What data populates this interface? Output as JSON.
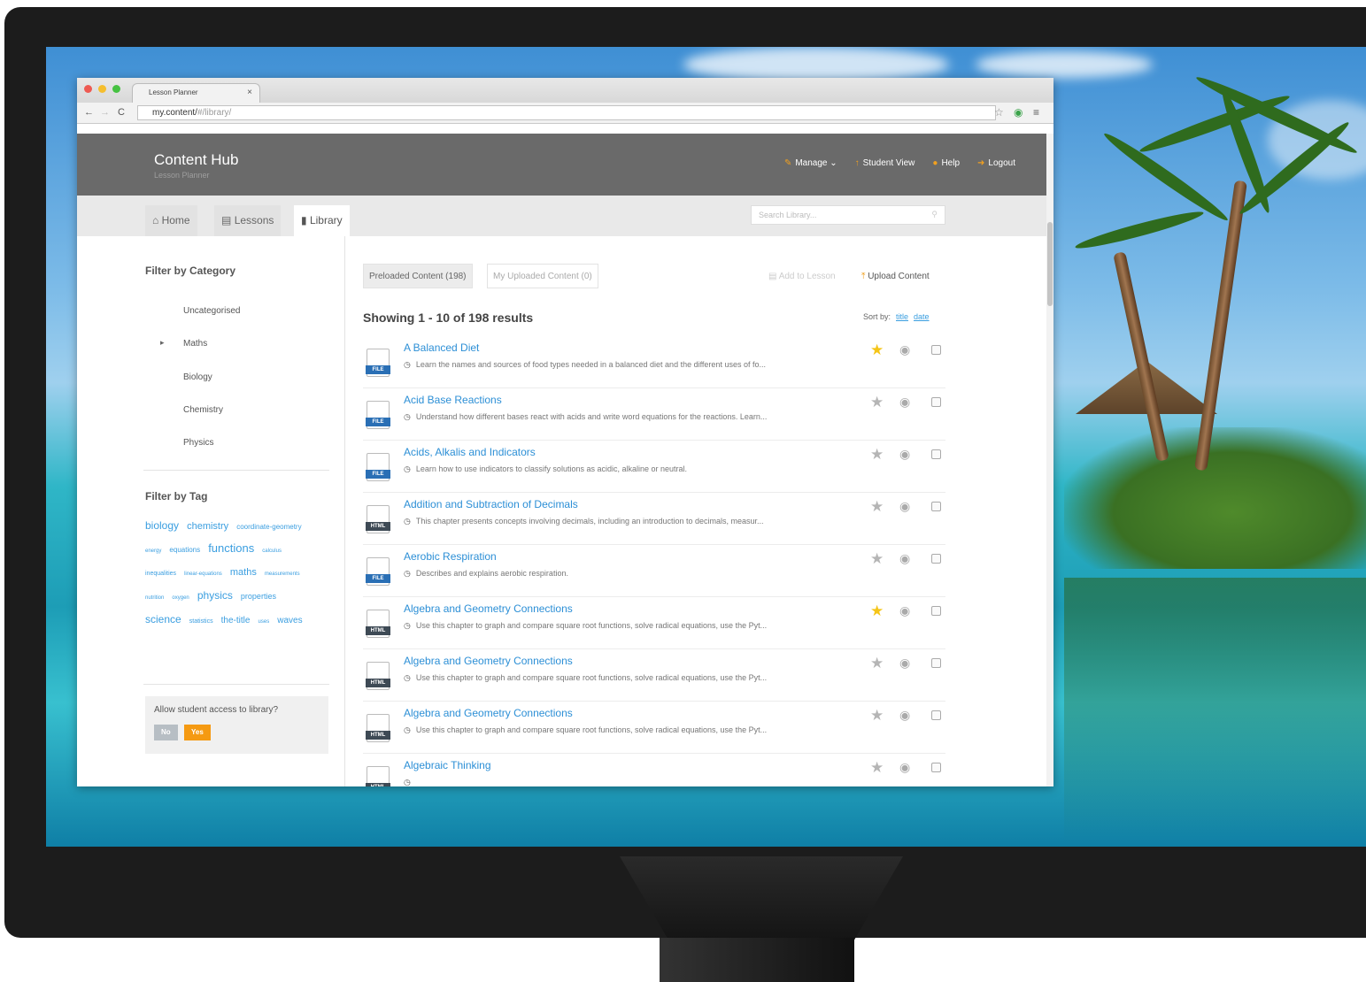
{
  "browser": {
    "tab_title": "Lesson Planner",
    "url_host": "my.content/",
    "url_path": "#/library/"
  },
  "header": {
    "brand": "Content Hub",
    "subtitle": "Lesson Planner",
    "nav": [
      {
        "label": "Manage",
        "icon": "wrench-icon"
      },
      {
        "label": "Student View",
        "icon": "arrow-up-icon"
      },
      {
        "label": "Help",
        "icon": "help-icon"
      },
      {
        "label": "Logout",
        "icon": "logout-icon"
      }
    ]
  },
  "tabs": [
    {
      "label": "Home",
      "icon": "home-icon"
    },
    {
      "label": "Lessons",
      "icon": "book-icon"
    },
    {
      "label": "Library",
      "icon": "file-icon",
      "active": true
    }
  ],
  "search": {
    "placeholder": "Search Library..."
  },
  "sidebar": {
    "category_heading": "Filter by Category",
    "categories": [
      "Uncategorised",
      "Maths",
      "Biology",
      "Chemistry",
      "Physics"
    ],
    "tag_heading": "Filter by Tag",
    "tags": [
      "biology",
      "chemistry",
      "coordinate-geometry",
      "energy",
      "equations",
      "functions",
      "calculus",
      "inequalities",
      "linear-equations",
      "maths",
      "measurements",
      "nutrition",
      "oxygen",
      "physics",
      "properties",
      "science",
      "statistics",
      "the-title",
      "uses",
      "waves"
    ],
    "access_question": "Allow student access to library?",
    "toggle_no": "No",
    "toggle_yes": "Yes"
  },
  "main": {
    "tab_preloaded": "Preloaded Content (198)",
    "tab_uploaded": "My Uploaded Content (0)",
    "add_to_lesson": "Add to Lesson",
    "upload_content": "Upload Content",
    "results_text": "Showing 1 - 10 of 198 results",
    "sort_label": "Sort by:",
    "sort_title": "title",
    "sort_date": "date",
    "items": [
      {
        "title": "A Balanced Diet",
        "desc": "Learn the names and sources of food types needed in a balanced diet and the different uses of fo...",
        "type": "FILE",
        "starred": true
      },
      {
        "title": "Acid Base Reactions",
        "desc": "Understand how different bases react with acids and write word equations for the reactions. Learn...",
        "type": "FILE",
        "starred": false
      },
      {
        "title": "Acids, Alkalis and Indicators",
        "desc": "Learn how to use indicators to classify solutions as acidic, alkaline or neutral.",
        "type": "FILE",
        "starred": false
      },
      {
        "title": "Addition and Subtraction of Decimals",
        "desc": "This chapter presents concepts involving decimals, including an introduction to decimals, measur...",
        "type": "HTML",
        "starred": false
      },
      {
        "title": "Aerobic Respiration",
        "desc": "Describes and explains aerobic respiration.",
        "type": "FILE",
        "starred": false
      },
      {
        "title": "Algebra and Geometry Connections",
        "desc": "Use this chapter to graph and compare square root functions, solve radical equations, use the Pyt...",
        "type": "HTML",
        "starred": true
      },
      {
        "title": "Algebra and Geometry Connections",
        "desc": "Use this chapter to graph and compare square root functions, solve radical equations, use the Pyt...",
        "type": "HTML",
        "starred": false
      },
      {
        "title": "Algebra and Geometry Connections",
        "desc": "Use this chapter to graph and compare square root functions, solve radical equations, use the Pyt...",
        "type": "HTML",
        "starred": false
      },
      {
        "title": "Algebraic Thinking",
        "desc": "",
        "type": "HTML",
        "starred": false
      }
    ]
  },
  "colors": {
    "accent": "#2c8fd6",
    "header": "#6a6a6a",
    "orange": "#f0a020",
    "file_badge": "#2a6fb5",
    "html_badge": "#3e4a55"
  }
}
